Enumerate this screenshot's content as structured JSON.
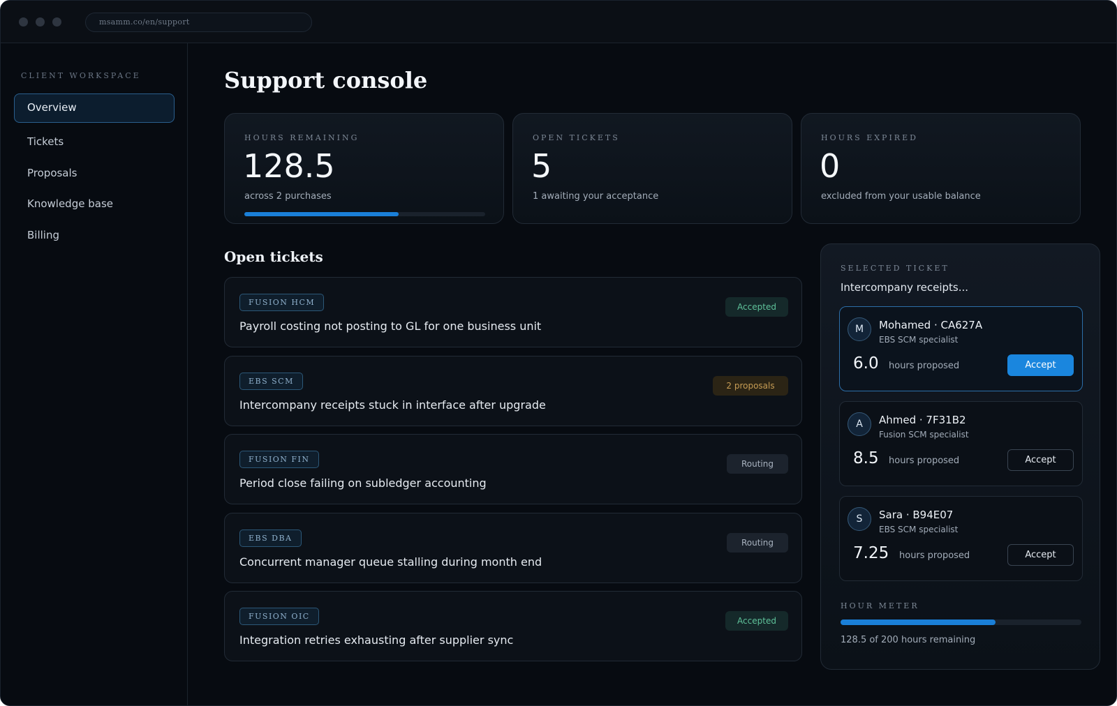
{
  "browser": {
    "url": "msamm.co/en/support"
  },
  "sidebar": {
    "heading": "CLIENT WORKSPACE",
    "items": [
      {
        "label": "Overview",
        "active": true
      },
      {
        "label": "Tickets",
        "active": false
      },
      {
        "label": "Proposals",
        "active": false
      },
      {
        "label": "Knowledge base",
        "active": false
      },
      {
        "label": "Billing",
        "active": false
      }
    ]
  },
  "page": {
    "title": "Support console"
  },
  "stats": [
    {
      "label": "HOURS REMAINING",
      "value": "128.5",
      "sub": "across 2 purchases",
      "progress": 0.64
    },
    {
      "label": "OPEN TICKETS",
      "value": "5",
      "sub": "1 awaiting your acceptance"
    },
    {
      "label": "HOURS EXPIRED",
      "value": "0",
      "sub": "excluded from your usable balance"
    }
  ],
  "tickets": {
    "title": "Open tickets",
    "items": [
      {
        "tag": "FUSION HCM",
        "title": "Payroll costing not posting to GL for one business unit",
        "status": "Accepted",
        "status_type": "accepted"
      },
      {
        "tag": "EBS SCM",
        "title": "Intercompany receipts stuck in interface after upgrade",
        "status": "2 proposals",
        "status_type": "proposals"
      },
      {
        "tag": "FUSION FIN",
        "title": "Period close failing on subledger accounting",
        "status": "Routing",
        "status_type": "routing"
      },
      {
        "tag": "EBS DBA",
        "title": "Concurrent manager queue stalling during month end",
        "status": "Routing",
        "status_type": "routing"
      },
      {
        "tag": "FUSION OIC",
        "title": "Integration retries exhausting after supplier sync",
        "status": "Accepted",
        "status_type": "accepted"
      }
    ]
  },
  "selected_ticket": {
    "label": "SELECTED TICKET",
    "subject": "Intercompany receipts...",
    "proposals": [
      {
        "initial": "M",
        "name": "Mohamed · CA627A",
        "role": "EBS SCM specialist",
        "hours": "6.0",
        "hours_label": "hours proposed",
        "button": "Accept",
        "selected": true
      },
      {
        "initial": "A",
        "name": "Ahmed · 7F31B2",
        "role": "Fusion SCM specialist",
        "hours": "8.5",
        "hours_label": "hours proposed",
        "button": "Accept",
        "selected": false
      },
      {
        "initial": "S",
        "name": "Sara · B94E07",
        "role": "EBS SCM specialist",
        "hours": "7.25",
        "hours_label": "hours proposed",
        "button": "Accept",
        "selected": false
      }
    ],
    "meter": {
      "label": "HOUR METER",
      "fraction": 0.6425,
      "text": "128.5 of 200 hours remaining"
    }
  },
  "colors": {
    "accent": "#1a7fd8",
    "background": "#070b11",
    "accepted": "#5fc29a",
    "proposals": "#c69c54"
  }
}
